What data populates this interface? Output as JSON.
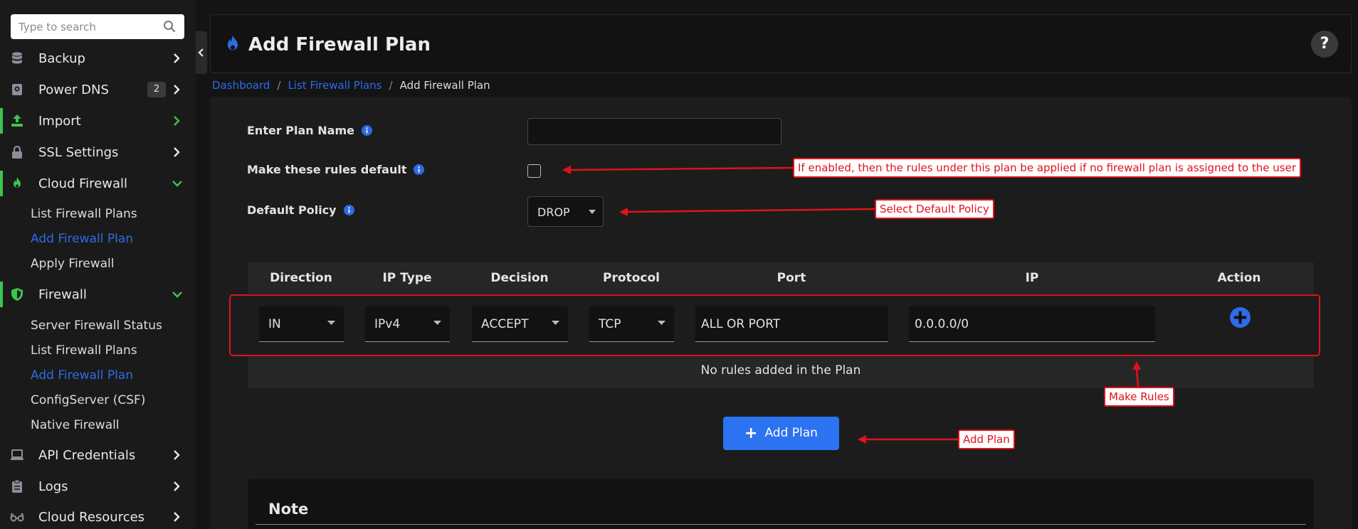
{
  "sidebar": {
    "search_placeholder": "Type to search",
    "items": [
      {
        "label": "Backup",
        "icon": "database-icon"
      },
      {
        "label": "Power DNS",
        "badge": "2",
        "icon": "dns-icon"
      },
      {
        "label": "Import",
        "icon": "upload-icon"
      },
      {
        "label": "SSL Settings",
        "icon": "lock-icon"
      },
      {
        "label": "Cloud Firewall",
        "icon": "flame-icon"
      },
      {
        "label": "Firewall",
        "icon": "shield-icon"
      },
      {
        "label": "API Credentials",
        "icon": "laptop-icon"
      },
      {
        "label": "Logs",
        "icon": "clipboard-icon"
      },
      {
        "label": "Cloud Resources",
        "icon": "glasses-icon"
      }
    ],
    "cloud_firewall_sub": [
      "List Firewall Plans",
      "Add Firewall Plan",
      "Apply Firewall"
    ],
    "firewall_sub": [
      "Server Firewall Status",
      "List Firewall Plans",
      "Add Firewall Plan",
      "ConfigServer (CSF)",
      "Native Firewall"
    ]
  },
  "header": {
    "title": "Add Firewall Plan",
    "help": "?"
  },
  "breadcrumb": {
    "dashboard": "Dashboard",
    "list": "List Firewall Plans",
    "current": "Add Firewall Plan"
  },
  "form": {
    "plan_name_label": "Enter Plan Name",
    "plan_name_value": "",
    "default_rules_label": "Make these rules default",
    "default_policy_label": "Default Policy",
    "default_policy_value": "DROP"
  },
  "rules_table": {
    "headers": [
      "Direction",
      "IP Type",
      "Decision",
      "Protocol",
      "Port",
      "IP",
      "Action"
    ],
    "direction": "IN",
    "ip_type": "IPv4",
    "decision": "ACCEPT",
    "protocol": "TCP",
    "port_placeholder": "ALL OR PORT",
    "ip_value": "0.0.0.0/0",
    "empty_text": "No rules added in the Plan"
  },
  "add_plan_label": "Add Plan",
  "note_title": "Note",
  "annotations": {
    "default_rules": "If enabled, then the rules under this plan be applied if no firewall plan is assigned to the user",
    "default_policy": "Select Default Policy",
    "make_rules": "Make Rules",
    "add_plan": "Add Plan"
  },
  "colors": {
    "accent": "#2e6be6",
    "active_bar": "#3bc451",
    "annotation": "#e0121b",
    "button": "#2b73f0"
  }
}
